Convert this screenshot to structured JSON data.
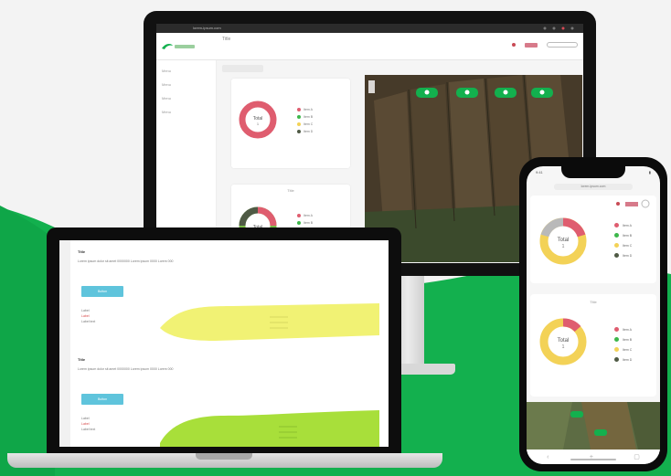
{
  "colors": {
    "brand_green": "#13b04e",
    "donut_red": "#df5d6f",
    "donut_yellow": "#f3d257",
    "donut_green": "#7bbd48",
    "donut_dark": "#4f5a45",
    "legend_green": "#3db74b",
    "wave_yellow": "#f1f274",
    "wave_lime": "#a8df3a"
  },
  "icons": [
    "globe-icon",
    "user-icon",
    "flag-icon",
    "bell-icon",
    "home-icon",
    "menu-icon",
    "back-icon"
  ],
  "desktop": {
    "url": "lorem-ipsum.com",
    "page_title": "Title",
    "donut_label": "Total",
    "donut_value": "1",
    "card2_title": "Title",
    "legend": [
      "Item A",
      "Item B",
      "Item C",
      "Item D"
    ],
    "sidebar_items": [
      "Menu",
      "Menu",
      "Menu",
      "Menu"
    ]
  },
  "laptop": {
    "block1_title": "Title",
    "block1_line": "Lorem ipsum dolor sit amet 0000000 Lorem ipsum 0000 Lorem 000",
    "block1_button": "Button",
    "block1_labels": [
      "Label",
      "Label",
      "Label text"
    ],
    "block2_title": "Title",
    "block2_line": "Lorem ipsum dolor sit amet 0000000 Lorem ipsum 0000 Lorem 000",
    "block2_button": "Button",
    "block2_labels": [
      "Label",
      "Label",
      "Label text"
    ]
  },
  "phone": {
    "time": "9:41",
    "url": "lorem-ipsum.com",
    "donut_label": "Total",
    "donut_value": "1",
    "card2_title": "Title",
    "legend": [
      "Item A",
      "Item B",
      "Item C",
      "Item D"
    ]
  }
}
